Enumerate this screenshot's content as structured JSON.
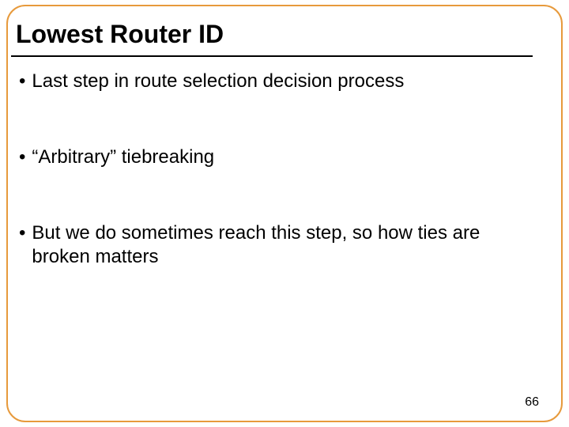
{
  "slide": {
    "title": "Lowest Router ID",
    "bullets": [
      "Last step in route selection decision process",
      "“Arbitrary” tiebreaking",
      "But we do sometimes reach this step, so how ties are broken matters"
    ],
    "pageNumber": "66"
  }
}
